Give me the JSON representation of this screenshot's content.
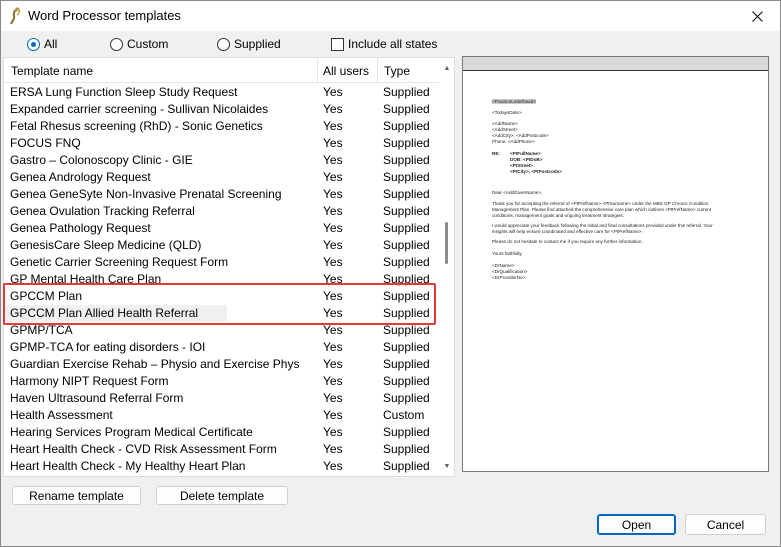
{
  "window": {
    "title": "Word Processor templates"
  },
  "filters": {
    "all_label": "All",
    "custom_label": "Custom",
    "supplied_label": "Supplied",
    "include_states_label": "Include all states"
  },
  "list": {
    "columns": {
      "name": "Template name",
      "users": "All users",
      "type": "Type"
    },
    "rows": [
      {
        "name": "ERSA Lung Function Sleep Study Request",
        "users": "Yes",
        "type": "Supplied"
      },
      {
        "name": "Expanded carrier screening - Sullivan Nicolaides",
        "users": "Yes",
        "type": "Supplied"
      },
      {
        "name": "Fetal Rhesus screening (RhD) - Sonic Genetics",
        "users": "Yes",
        "type": "Supplied"
      },
      {
        "name": "FOCUS FNQ",
        "users": "Yes",
        "type": "Supplied"
      },
      {
        "name": "Gastro – Colonoscopy Clinic - GIE",
        "users": "Yes",
        "type": "Supplied"
      },
      {
        "name": "Genea Andrology Request",
        "users": "Yes",
        "type": "Supplied"
      },
      {
        "name": "Genea GeneSyte Non-Invasive Prenatal Screening",
        "users": "Yes",
        "type": "Supplied"
      },
      {
        "name": "Genea Ovulation Tracking Referral",
        "users": "Yes",
        "type": "Supplied"
      },
      {
        "name": "Genea Pathology Request",
        "users": "Yes",
        "type": "Supplied"
      },
      {
        "name": "GenesisCare Sleep Medicine (QLD)",
        "users": "Yes",
        "type": "Supplied"
      },
      {
        "name": "Genetic Carrier Screening Request Form",
        "users": "Yes",
        "type": "Supplied"
      },
      {
        "name": "GP Mental Health Care Plan",
        "users": "Yes",
        "type": "Supplied"
      },
      {
        "name": "GPCCM Plan",
        "users": "Yes",
        "type": "Supplied"
      },
      {
        "name": "GPCCM Plan Allied Health Referral",
        "users": "Yes",
        "type": "Supplied"
      },
      {
        "name": "GPMP/TCA",
        "users": "Yes",
        "type": "Supplied"
      },
      {
        "name": "GPMP-TCA for eating disorders - IOI",
        "users": "Yes",
        "type": "Supplied"
      },
      {
        "name": "Guardian Exercise Rehab – Physio and Exercise Phys",
        "users": "Yes",
        "type": "Supplied"
      },
      {
        "name": "Harmony NIPT Request Form",
        "users": "Yes",
        "type": "Supplied"
      },
      {
        "name": "Haven Ultrasound Referral Form",
        "users": "Yes",
        "type": "Supplied"
      },
      {
        "name": "Health Assessment",
        "users": "Yes",
        "type": "Custom"
      },
      {
        "name": "Hearing Services Program Medical Certificate",
        "users": "Yes",
        "type": "Supplied"
      },
      {
        "name": "Heart Health Check - CVD Risk Assessment Form",
        "users": "Yes",
        "type": "Supplied"
      },
      {
        "name": "Heart Health Check - My Healthy Heart Plan",
        "users": "Yes",
        "type": "Supplied"
      }
    ]
  },
  "preview": {
    "practice_letterhead": "<PracticeLetterhead>",
    "today": "<TodaysDate>",
    "addr_name": "<AddName>",
    "addr_street": "<AddStreet>",
    "addr_city": "<AddCity>, <AddPostcode>",
    "addr_phone": "Phone: <AddPhone>",
    "re_label": "RE:",
    "re_name": "<PtFullName>",
    "re_dob": "DOB: <PtDoB>",
    "re_street": "<PtStreet>",
    "re_city": "<PtCity>, <PtPostcode>",
    "dear": "Dear <AddGivenName>,",
    "para1a": "Thank you for accepting the referral of <PtPrefName> <PtSurname> under the MBS GP Chronic Condition",
    "para1b": "Management Plan. Please find attached the comprehensive care plan which outlines <PtPrefName> current",
    "para1c": "conditions, management goals and ongoing treatment strategies.",
    "para2a": "I would appreciate your feedback following the initial and final consultations provided under this referral. Your",
    "para2b": "insights will help ensure coordinated and effective care for <PtPrefName>.",
    "para3": "Please do not hesitate to contact me if you require any further information.",
    "closing": "Yours faithfully,",
    "sig_name": "<DrName>",
    "sig_qual": "<DrQualification>",
    "sig_provider": "<DrProviderNo>"
  },
  "buttons": {
    "rename": "Rename template",
    "delete": "Delete template",
    "open": "Open",
    "cancel": "Cancel"
  },
  "colors": {
    "accent": "#0067c0",
    "highlight_border": "#e33b3b"
  }
}
